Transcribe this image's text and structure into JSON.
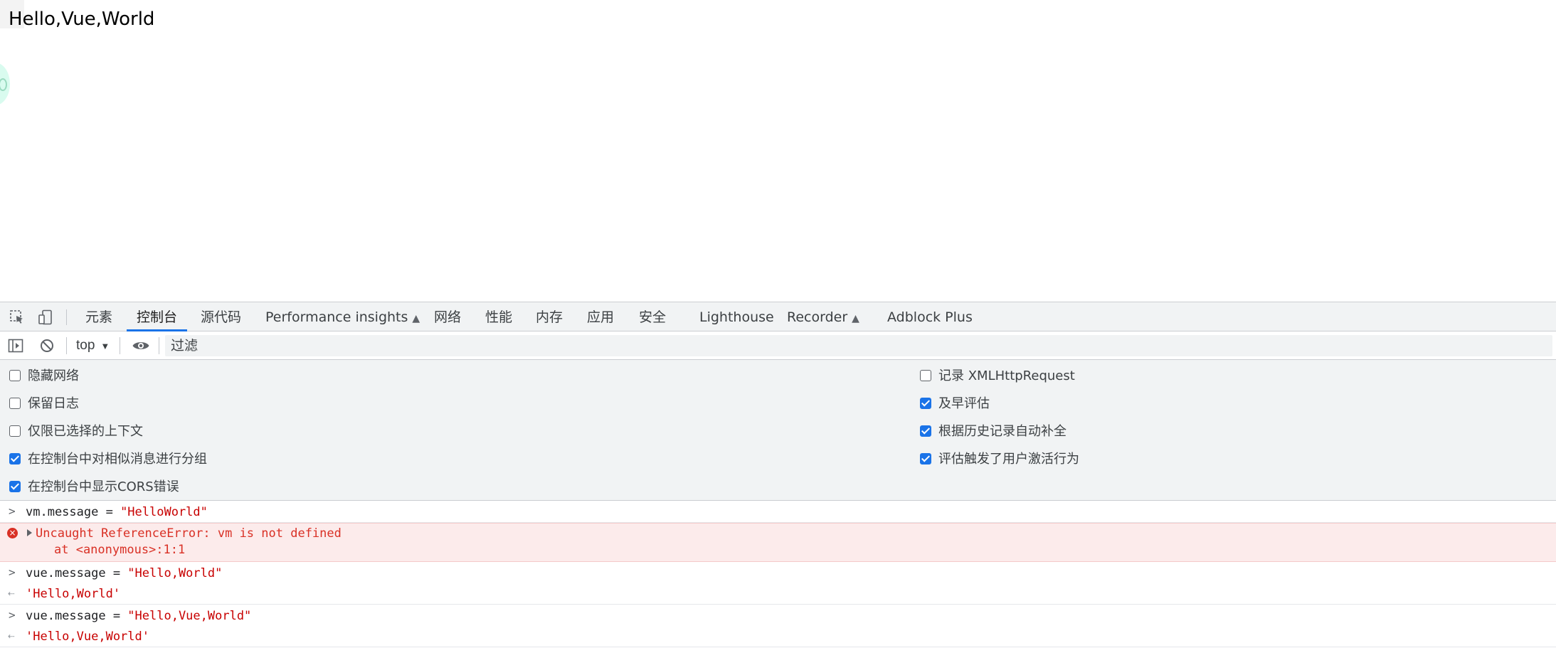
{
  "page": {
    "text": "Hello,Vue,World"
  },
  "devtools": {
    "tabs": [
      {
        "label": "元素"
      },
      {
        "label": "控制台",
        "active": true
      },
      {
        "label": "源代码"
      },
      {
        "label": "Performance insights",
        "experimental": true
      },
      {
        "label": "网络"
      },
      {
        "label": "性能"
      },
      {
        "label": "内存"
      },
      {
        "label": "应用"
      },
      {
        "label": "安全"
      },
      {
        "label": "Lighthouse"
      },
      {
        "label": "Recorder",
        "experimental": true
      },
      {
        "label": "Adblock Plus"
      }
    ],
    "toolbar": {
      "context": "top",
      "filter_placeholder": "过滤"
    },
    "settings": {
      "left": [
        {
          "label": "隐藏网络",
          "checked": false
        },
        {
          "label": "保留日志",
          "checked": false
        },
        {
          "label": "仅限已选择的上下文",
          "checked": false
        },
        {
          "label": "在控制台中对相似消息进行分组",
          "checked": true
        },
        {
          "label": "在控制台中显示CORS错误",
          "checked": true
        }
      ],
      "right": [
        {
          "label": "记录 XMLHttpRequest",
          "checked": false
        },
        {
          "label": "及早评估",
          "checked": true
        },
        {
          "label": "根据历史记录自动补全",
          "checked": true
        },
        {
          "label": "评估触发了用户激活行为",
          "checked": true
        }
      ]
    },
    "console": {
      "entry1": {
        "code": "vm.message = ",
        "str": "\"HelloWorld\""
      },
      "error": {
        "message": "Uncaught ReferenceError: vm is not defined",
        "stack": "at <anonymous>:1:1"
      },
      "entry2": {
        "code": "vue.message = ",
        "str": "\"Hello,World\"",
        "result": "'Hello,World'"
      },
      "entry3": {
        "code": "vue.message = ",
        "str": "\"Hello,Vue,World\"",
        "result": "'Hello,Vue,World'"
      }
    }
  }
}
